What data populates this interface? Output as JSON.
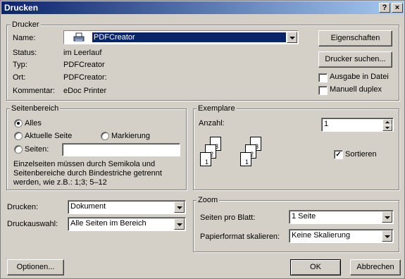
{
  "window": {
    "title": "Drucken",
    "help_btn": "?",
    "close_btn": "×"
  },
  "printer_group": {
    "label": "Drucker",
    "name_label": "Name:",
    "name_value": "PDFCreator",
    "status_label": "Status:",
    "status_value": "im Leerlauf",
    "type_label": "Typ:",
    "type_value": "PDFCreator",
    "location_label": "Ort:",
    "location_value": "PDFCreator:",
    "comment_label": "Kommentar:",
    "comment_value": "eDoc Printer",
    "properties_btn": "Eigenschaften",
    "find_printer_btn": "Drucker suchen...",
    "print_to_file_label": "Ausgabe in Datei",
    "print_to_file_checked": false,
    "duplex_label": "Manuell duplex",
    "duplex_checked": false
  },
  "range_group": {
    "label": "Seitenbereich",
    "all_label": "Alles",
    "current_label": "Aktuelle Seite",
    "selection_label": "Markierung",
    "pages_label": "Seiten:",
    "pages_value": "",
    "selected": "all",
    "hint": "Einzelseiten müssen durch Semikola und Seitenbereiche durch Bindestriche getrennt werden, wie z.B.: 1;3; 5–12"
  },
  "copies_group": {
    "label": "Exemplare",
    "count_label": "Anzahl:",
    "count_value": "1",
    "collate_label": "Sortieren",
    "collate_checked": true,
    "page_nums": [
      "1",
      "2",
      "3"
    ]
  },
  "print_what": {
    "label": "Drucken:",
    "value": "Dokument"
  },
  "print_select": {
    "label": "Druckauswahl:",
    "value": "Alle Seiten im Bereich"
  },
  "zoom_group": {
    "label": "Zoom",
    "pages_per_sheet_label": "Seiten pro Blatt:",
    "pages_per_sheet_value": "1 Seite",
    "scale_label": "Papierformat skalieren:",
    "scale_value": "Keine Skalierung"
  },
  "footer": {
    "options_btn": "Optionen...",
    "ok_btn": "OK",
    "cancel_btn": "Abbrechen"
  }
}
